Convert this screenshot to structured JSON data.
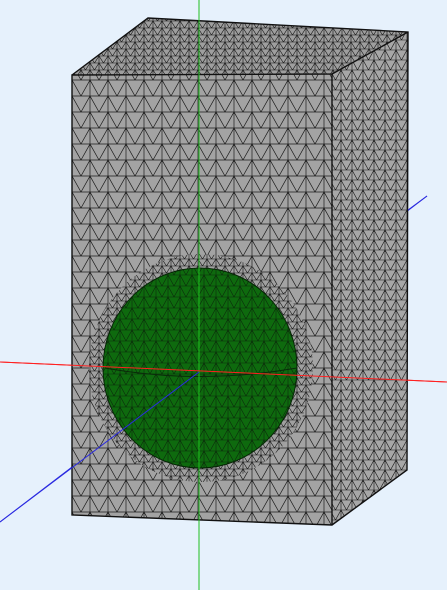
{
  "viewport": {
    "background": "#e6f1fc"
  },
  "colors": {
    "mesh_face": "#a3a3a3",
    "mesh_face_top": "#9e9e9e",
    "mesh_face_side": "#a7a7a7",
    "mesh_edge": "#111111",
    "inner_solid": "#0e6a0e",
    "axis_x": "#ff2020",
    "axis_y": "#20c020",
    "axis_z": "#2a2ae0"
  },
  "scene": {
    "objects": [
      {
        "name": "outer-box",
        "kind": "tetrahedral-mesh",
        "shape": "box"
      },
      {
        "name": "inner-sphere",
        "kind": "tetrahedral-mesh",
        "shape": "sphere"
      }
    ],
    "axes": [
      "x-axis",
      "y-axis",
      "z-axis"
    ]
  }
}
